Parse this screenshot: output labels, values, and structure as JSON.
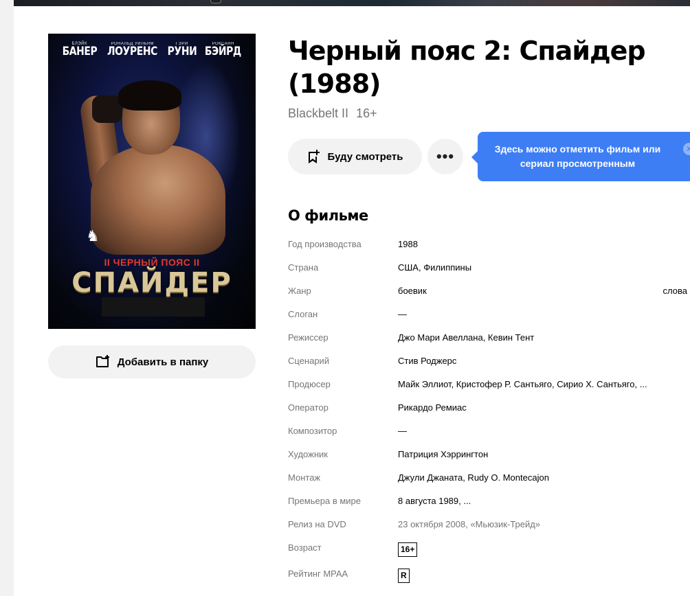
{
  "poster": {
    "actors": [
      {
        "first": "БЛЭЙК",
        "last": "БАНЕР"
      },
      {
        "first": "РОНАЛЬД УИЛЬЯМ",
        "last": "ЛОУРЕНС"
      },
      {
        "first": "ГЭРИ",
        "last": "РУНИ"
      },
      {
        "first": "РОКСАНН",
        "last": "БЭЙРД"
      }
    ],
    "subtitle": "II ЧЕРНЫЙ ПОЯС II",
    "big_title": "СПАЙДЕР"
  },
  "add_folder_label": "Добавить в папку",
  "movie": {
    "title": "Черный пояс 2: Спайдер (1988)",
    "original_title": "Blackbelt II",
    "age": "16+"
  },
  "actions": {
    "watch_label": "Буду смотреть",
    "more_label": "•••"
  },
  "tooltip": {
    "text": "Здесь можно отметить фильм или сериал просмотренным"
  },
  "about": {
    "title": "О фильме",
    "rows": [
      {
        "key": "Год производства",
        "value": "1988"
      },
      {
        "key": "Страна",
        "value": "США, Филиппины"
      },
      {
        "key": "Жанр",
        "value": "боевик",
        "extra": "слова"
      },
      {
        "key": "Слоган",
        "value": "—"
      },
      {
        "key": "Режиссер",
        "value": "Джо Мари Авеллана, Кевин Тент"
      },
      {
        "key": "Сценарий",
        "value": "Стив Роджерс"
      },
      {
        "key": "Продюсер",
        "value": "Майк Эллиот, Кристофер Р. Сантьяго, Сирио Х. Сантьяго, ..."
      },
      {
        "key": "Оператор",
        "value": "Рикардо Ремиас"
      },
      {
        "key": "Композитор",
        "value": "—"
      },
      {
        "key": "Художник",
        "value": "Патриция Хэррингтон"
      },
      {
        "key": "Монтаж",
        "value": "Джули Джаната, Rudy O. Montecajon"
      },
      {
        "key": "Премьера в мире",
        "value": "8 августа 1989, ..."
      },
      {
        "key": "Релиз на DVD",
        "value": "23 октября 2008, «Мьюзик-Трейд»"
      },
      {
        "key": "Возраст",
        "value": "16+"
      },
      {
        "key": "Рейтинг MPAA",
        "value": "R"
      }
    ]
  }
}
